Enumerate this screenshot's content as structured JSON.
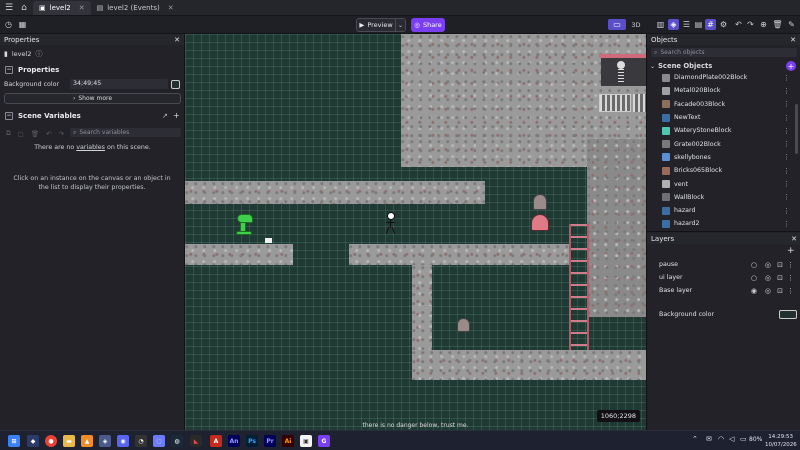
{
  "titlebar": {
    "tabs": [
      {
        "label": "level2",
        "active": true
      },
      {
        "label": "level2 (Events)",
        "active": false
      }
    ]
  },
  "toolbar": {
    "preview_label": "Preview",
    "share_label": "Share",
    "mode_3d": "3D",
    "accent": "#7b3ff2"
  },
  "properties": {
    "panel_title": "Properties",
    "scene_name": "level2",
    "section_title": "Properties",
    "bg_color_label": "Background color",
    "bg_color_value": "34;49;45",
    "show_more": "Show more",
    "scene_variables_title": "Scene Variables",
    "search_variables_placeholder": "Search variables",
    "no_variables_pre": "There are no ",
    "no_variables_link": "variables",
    "no_variables_post": " on this scene.",
    "hint": "Click on an instance on the canvas or an object in the list to display their properties."
  },
  "canvas": {
    "coords": "1060;2298",
    "message": "there is no danger below, trust me.",
    "background": "#1f3a33"
  },
  "objects": {
    "panel_title": "Objects",
    "search_placeholder": "Search objects",
    "group_title": "Scene Objects",
    "items": [
      {
        "label": "DiamondPlate002Block",
        "color": "#8a8a8e"
      },
      {
        "label": "Metal020Block",
        "color": "#9ea0a4"
      },
      {
        "label": "Facade003Block",
        "color": "#8c6f5d"
      },
      {
        "label": "NewText",
        "color": "#3a6ea5"
      },
      {
        "label": "WateryStoneBlock",
        "color": "#4fc7b0"
      },
      {
        "label": "Grate002Block",
        "color": "#7a7a7a"
      },
      {
        "label": "skellybones",
        "color": "#5b8fd1"
      },
      {
        "label": "Bricks065Block",
        "color": "#9a6a5a"
      },
      {
        "label": "vent",
        "color": "#b0b0b0"
      },
      {
        "label": "WallBlock",
        "color": "#6f6f75"
      },
      {
        "label": "hazard",
        "color": "#3a6ea5"
      },
      {
        "label": "hazard2",
        "color": "#3a6ea5"
      }
    ]
  },
  "layers": {
    "panel_title": "Layers",
    "items": [
      {
        "label": "pause",
        "selected": false
      },
      {
        "label": "ui layer",
        "selected": false
      },
      {
        "label": "Base layer",
        "selected": true
      }
    ],
    "bg_label": "Background color"
  },
  "taskbar": {
    "battery": "80%",
    "time": "14:29:53",
    "date": "10/07/2026"
  }
}
